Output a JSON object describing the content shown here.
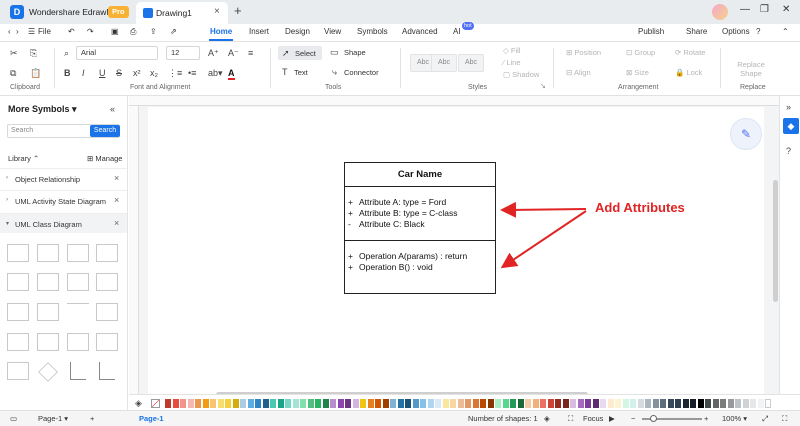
{
  "app": {
    "name": "Wondershare EdrawMax",
    "badge": "Pro"
  },
  "tab": {
    "title": "Drawing1"
  },
  "menu": {
    "file": "File",
    "items": [
      "Home",
      "Insert",
      "Design",
      "View",
      "Symbols",
      "Advanced",
      "AI"
    ],
    "active": "Home",
    "ai_badge": "hot",
    "publish": "Publish",
    "share": "Share",
    "options": "Options"
  },
  "ribbon": {
    "font_name": "Arial",
    "font_size": "12",
    "select": "Select",
    "shape": "Shape",
    "text": "Text",
    "connector": "Connector",
    "style_samples": [
      "Abc",
      "Abc",
      "Abc"
    ],
    "fill": "Fill",
    "line": "Line",
    "shadow": "Shadow",
    "position": "Position",
    "group": "Group",
    "rotate": "Rotate",
    "align": "Align",
    "size": "Size",
    "lock": "Lock",
    "replace_shape": [
      "Replace",
      "Shape"
    ],
    "groups": {
      "clipboard": "Clipboard",
      "font": "Font and Alignment",
      "tools": "Tools",
      "styles": "Styles",
      "arrangement": "Arrangement",
      "replace": "Replace"
    }
  },
  "sidebar": {
    "title": "More Symbols",
    "search_placeholder": "Search",
    "search_button": "Search",
    "library": "Library",
    "manage": "Manage",
    "libraries": [
      "Object Relationship",
      "UML Activity State Diagram",
      "UML Class Diagram"
    ]
  },
  "uml": {
    "title": "Car Name",
    "attributes": [
      {
        "sign": "+",
        "text": "Attribute A: type = Ford"
      },
      {
        "sign": "+",
        "text": "Attribute B: type = C-class"
      },
      {
        "sign": "-",
        "text": "Attribute C: Black"
      }
    ],
    "operations": [
      {
        "sign": "+",
        "text": "Operation A(params) : return"
      },
      {
        "sign": "+",
        "text": "Operation B() : void"
      }
    ]
  },
  "annotation": {
    "text": "Add Attributes",
    "color": "#e02424"
  },
  "status": {
    "page_selector": "Page-1",
    "page_tab": "Page-1",
    "shapes_count": "Number of shapes: 1",
    "focus": "Focus",
    "zoom": "100%"
  },
  "colors": {
    "accent": "#1a73e8",
    "palette": [
      "#c0392b",
      "#e74c3c",
      "#f1948a",
      "#f5b7b1",
      "#eb984e",
      "#f39c12",
      "#f8c471",
      "#f7dc6f",
      "#f4d03f",
      "#d4ac0d",
      "#a9cce3",
      "#5dade2",
      "#2e86c1",
      "#1f618d",
      "#48c9b0",
      "#17a589",
      "#76d7c4",
      "#a3e4d7",
      "#82e0aa",
      "#52be80",
      "#28b463",
      "#1e8449",
      "#bb8fce",
      "#8e44ad",
      "#6c3483",
      "#d2b4de",
      "#f1c40f",
      "#e67e22",
      "#d35400",
      "#a04000",
      "#7fb3d5",
      "#2471a3",
      "#1a5276",
      "#5499c7",
      "#85c1e9",
      "#aed6f1",
      "#d6eaf8",
      "#f9e79f",
      "#fad7a0",
      "#edbb99",
      "#e59866",
      "#dc7633",
      "#ba4a00",
      "#873600",
      "#abebc6",
      "#58d68d",
      "#239b56",
      "#186a3b",
      "#f5cba7",
      "#f0b27a",
      "#ec7063",
      "#cb4335",
      "#922b21",
      "#7b241c",
      "#d7bde2",
      "#a569bd",
      "#7d3c98",
      "#5b2c6f",
      "#e8daef",
      "#fdebd0",
      "#fcf3cf",
      "#d5f5e3",
      "#d1f2eb",
      "#d6dbdf",
      "#aeb6bf",
      "#85929e",
      "#5d6d7e",
      "#34495e",
      "#2c3e50",
      "#1b2631",
      "#17202a",
      "#000000",
      "#424949",
      "#626567",
      "#7b7d7d",
      "#979a9a",
      "#bdc3c7",
      "#d0d3d4",
      "#e5e7e9",
      "#f2f3f4",
      "#ffffff"
    ]
  }
}
